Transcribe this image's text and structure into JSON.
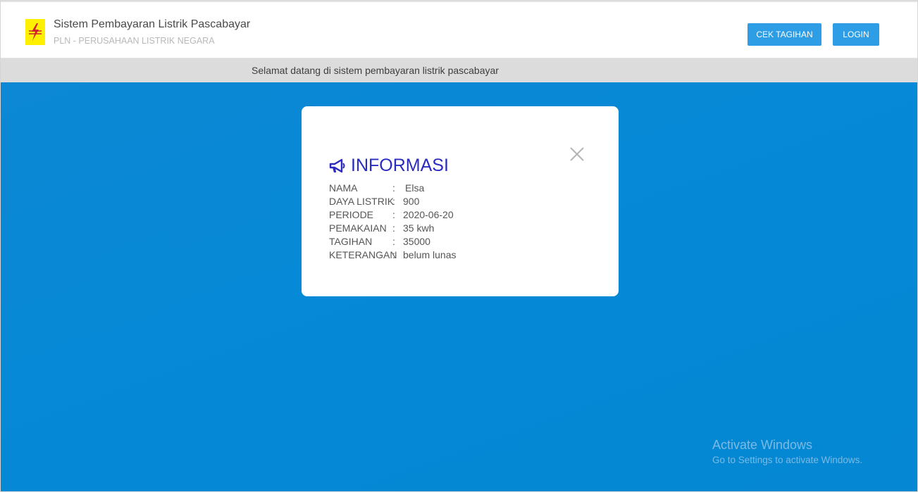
{
  "header": {
    "app_title": "Sistem Pembayaran Listrik Pascabayar",
    "app_subtitle": "PLN - PERUSAHAAN LISTRIK NEGARA",
    "buttons": {
      "cek_tagihan": "CEK TAGIHAN",
      "login": "LOGIN"
    },
    "accent_color": "#2d9ee6",
    "logo_color": "#ffef00",
    "logo_icon": "pln-lightning-logo"
  },
  "welcome": {
    "text": "Selamat datang di sistem pembayaran listrik pascabayar"
  },
  "background": {
    "color": "#0589d6"
  },
  "modal": {
    "heading": "INFORMASI",
    "heading_icon": "megaphone-icon",
    "heading_color": "#2b2bbf",
    "close_icon": "close-icon",
    "rows": [
      {
        "label": "NAMA",
        "colon": ":",
        "value": "Elsa"
      },
      {
        "label": "DAYA LISTRIK",
        "colon": ":",
        "value": "900"
      },
      {
        "label": "PERIODE",
        "colon": ":",
        "value": "2020-06-20"
      },
      {
        "label": "PEMAKAIAN",
        "colon": ":",
        "value": "35 kwh"
      },
      {
        "label": "TAGIHAN",
        "colon": ":",
        "value": "35000"
      },
      {
        "label": "KETERANGAN",
        "colon": ":",
        "value": "belum lunas"
      }
    ]
  },
  "watermark": {
    "title": "Activate Windows",
    "subtitle": "Go to Settings to activate Windows."
  }
}
